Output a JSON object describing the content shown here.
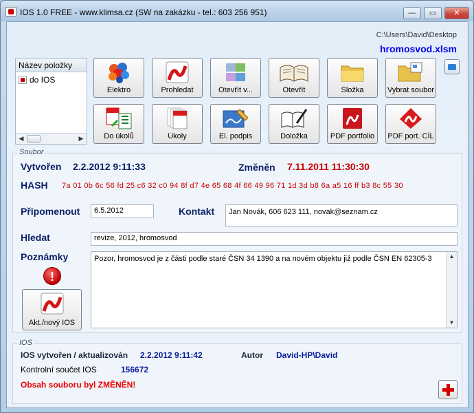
{
  "window": {
    "title": "IOS 1.0 FREE - www.klimsa.cz (SW na zakázku - tel.: 603 256 951)",
    "minimize": "—",
    "maximize": "▭",
    "close": "✕"
  },
  "header": {
    "path": "C:\\Users\\David\\Desktop",
    "file": "hromosvod.xlsm"
  },
  "tree": {
    "header": "Název položky",
    "items": [
      {
        "label": "do IOS"
      }
    ]
  },
  "toolbar": {
    "row1": [
      {
        "label": "Elektro",
        "icon": "molecule-icon"
      },
      {
        "label": "Prohledat",
        "icon": "search-pdf-icon"
      },
      {
        "label": "Otevřít v...",
        "icon": "open-with-icon"
      },
      {
        "label": "Otevřít",
        "icon": "open-book-icon"
      },
      {
        "label": "Složka",
        "icon": "folder-icon"
      },
      {
        "label": "Vybrat soubor",
        "icon": "select-file-icon"
      }
    ],
    "row2": [
      {
        "label": "Do úkolů",
        "icon": "pdf-to-excel-icon"
      },
      {
        "label": "Úkoly",
        "icon": "pdf-stack-icon"
      },
      {
        "label": "El. podpis",
        "icon": "signature-icon"
      },
      {
        "label": "Doložka",
        "icon": "book-pen-icon"
      },
      {
        "label": "PDF portfolio",
        "icon": "pdf-portfolio-icon"
      },
      {
        "label": "PDF port. CÍL",
        "icon": "pdf-target-icon"
      }
    ]
  },
  "soubor": {
    "title": "Soubor",
    "created_label": "Vytvořen",
    "created_value": "2.2.2012 9:11:33",
    "changed_label": "Změněn",
    "changed_value": "7.11.2011 11:30:30",
    "hash_label": "HASH",
    "hash_value": "7a 01 0b 6c 56 fd 25 c6 32 c0 94 8f d7 4e 65 68 4f 66 49 96 71 1d 3d b8 6a a5 16 ff b3 8c 55 30",
    "remind_label": "Připomenout",
    "remind_value": "6.5.2012",
    "contact_label": "Kontakt",
    "contact_value": "Jan Novák, 606  623 111, novak@seznam.cz",
    "search_label": "Hledat",
    "search_value": "revize, 2012, hromosvod",
    "notes_label": "Poznámky",
    "notes_value": "Pozor, hromosvod je z části podle staré ČSN 34 1390 a na novém objektu již podle ČSN EN 62305-3",
    "warn_symbol": "!",
    "update_label": "Akt./nový IOS"
  },
  "ios": {
    "title": "IOS",
    "created_label": "IOS vytvořen / aktualizován",
    "created_value": "2.2.2012 9:11:42",
    "author_label": "Autor",
    "author_value": "David-HP\\David",
    "checksum_label": "Kontrolní součet IOS",
    "checksum_value": "156672",
    "status": "Obsah souboru byl ZMĚNĚN!"
  }
}
